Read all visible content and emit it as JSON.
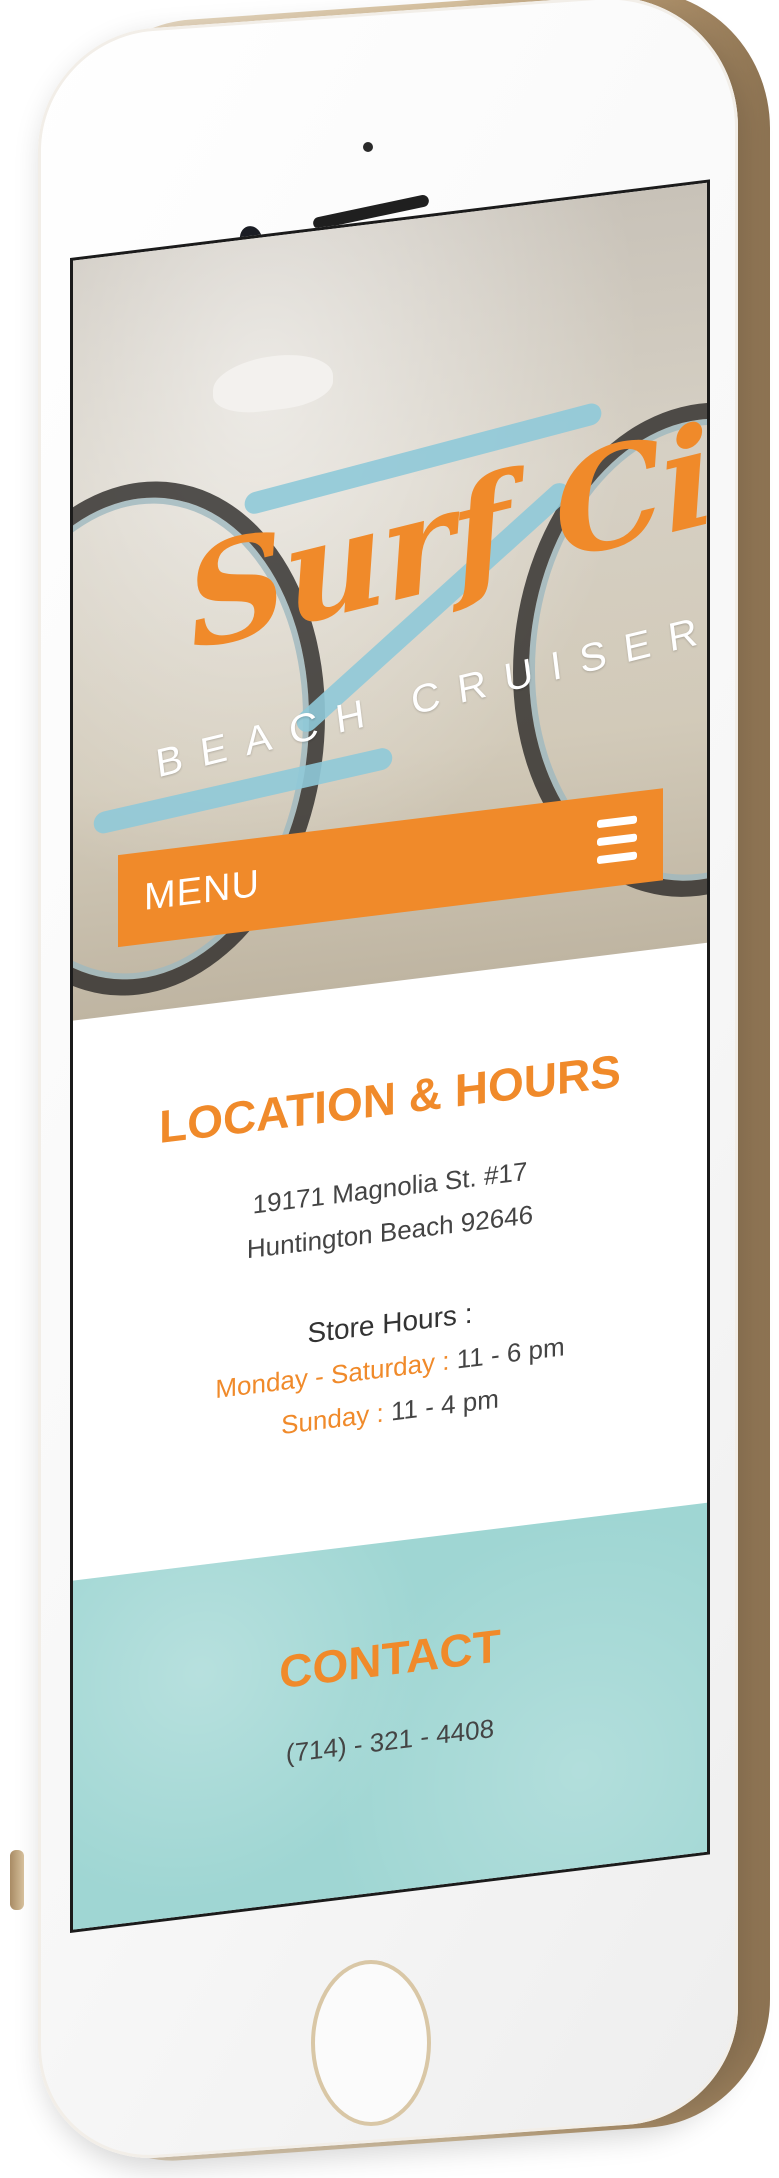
{
  "hero": {
    "logo_script": "Surf City",
    "logo_subtitle": "BEACH CRUISERS",
    "menu_label": "MENU"
  },
  "location": {
    "title": "LOCATION & HOURS",
    "address_line1": "19171 Magnolia St. #17",
    "address_line2": "Huntington Beach  92646",
    "hours_title": "Store Hours :",
    "hours": [
      {
        "day": "Monday - Saturday :",
        "time": " 11  -  6 pm"
      },
      {
        "day": "Sunday :",
        "time": " 11  -  4  pm"
      }
    ]
  },
  "contact": {
    "title": "CONTACT",
    "phone": "(714)  - 321 - 4408"
  },
  "colors": {
    "accent_orange": "#f08a2a",
    "contact_teal": "#9fd6d3",
    "phone_gold": "#d9c3a0"
  },
  "icons": {
    "menu": "hamburger-icon"
  }
}
